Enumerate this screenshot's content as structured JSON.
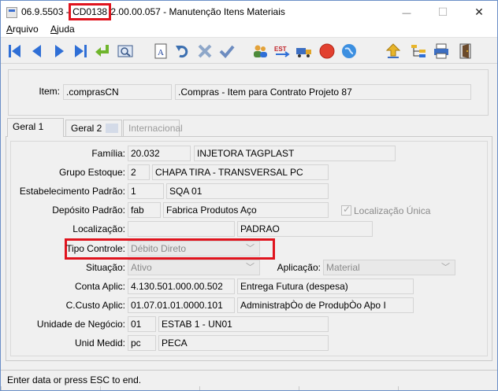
{
  "window": {
    "title_prefix": "06.9.5503 - ",
    "title_code": "CD0138",
    "title_suffix": " 2.00.00.057 - Manutenção Itens Materiais",
    "min_icon": "—",
    "max_icon": "☐",
    "close_icon": "✕"
  },
  "menu": {
    "arquivo": {
      "first": "A",
      "rest": "rquivo"
    },
    "ajuda": {
      "first": "A",
      "rest": "juda"
    }
  },
  "toolbar": {
    "icons": [
      "first-record-icon",
      "prev-record-icon",
      "next-record-icon",
      "last-record-icon",
      "return-icon",
      "zoom-icon",
      "add-icon",
      "undo-icon",
      "cancel-icon",
      "confirm-icon",
      "users-icon",
      "est-icon",
      "truck-icon",
      "stop-icon",
      "globe-icon",
      "upload-icon",
      "tree-icon",
      "print-icon",
      "exit-icon"
    ],
    "est_label": "EST",
    "add_label": "A"
  },
  "item": {
    "label": "Item:",
    "code": ".comprasCN",
    "description": ".Compras - Item para Contrato Projeto 87"
  },
  "tabs": [
    {
      "label": "Geral 1",
      "state": "active"
    },
    {
      "label": "Geral 2",
      "state": "normal"
    },
    {
      "label": "Internacional",
      "state": "disabled"
    }
  ],
  "form": {
    "familia": {
      "label": "Família:",
      "code": "20.032",
      "desc": "INJETORA TAGPLAST"
    },
    "grupo": {
      "label": "Grupo Estoque:",
      "code": "2",
      "desc": "CHAPA TIRA   - TRANSVERSAL  PC"
    },
    "estab": {
      "label": "Estabelecimento Padrão:",
      "code": "1",
      "desc": "SQA 01"
    },
    "deposito": {
      "label": "Depósito Padrão:",
      "code": "fab",
      "desc": "Fabrica Produtos Aço",
      "check_label": "Localização Única"
    },
    "localizacao": {
      "label": "Localização:",
      "code": "",
      "desc": "PADRAO"
    },
    "tipo": {
      "label": "Tipo Controle:",
      "value": "Débito Direto"
    },
    "situacao": {
      "label": "Situação:",
      "value": "Ativo"
    },
    "aplicacao": {
      "label": "Aplicação:",
      "value": "Material"
    },
    "conta": {
      "label": "Conta Aplic:",
      "code": "4.130.501.000.00.502",
      "desc": "Entrega Futura (despesa)"
    },
    "ccusto": {
      "label": "C.Custo Aplic:",
      "code": "01.07.01.01.0000.101",
      "desc": "AdministraþÒo de ProduþÒo Aþo I"
    },
    "unidade": {
      "label": "Unidade de Negócio:",
      "code": "01",
      "desc": "ESTAB 1 - UN01"
    },
    "medida": {
      "label": "Unid Medid:",
      "code": "pc",
      "desc": "PECA"
    }
  },
  "status": {
    "text": "Enter data or press ESC to end."
  },
  "colors": {
    "highlight": "#e0141e",
    "nav_blue": "#2f6fd6"
  }
}
